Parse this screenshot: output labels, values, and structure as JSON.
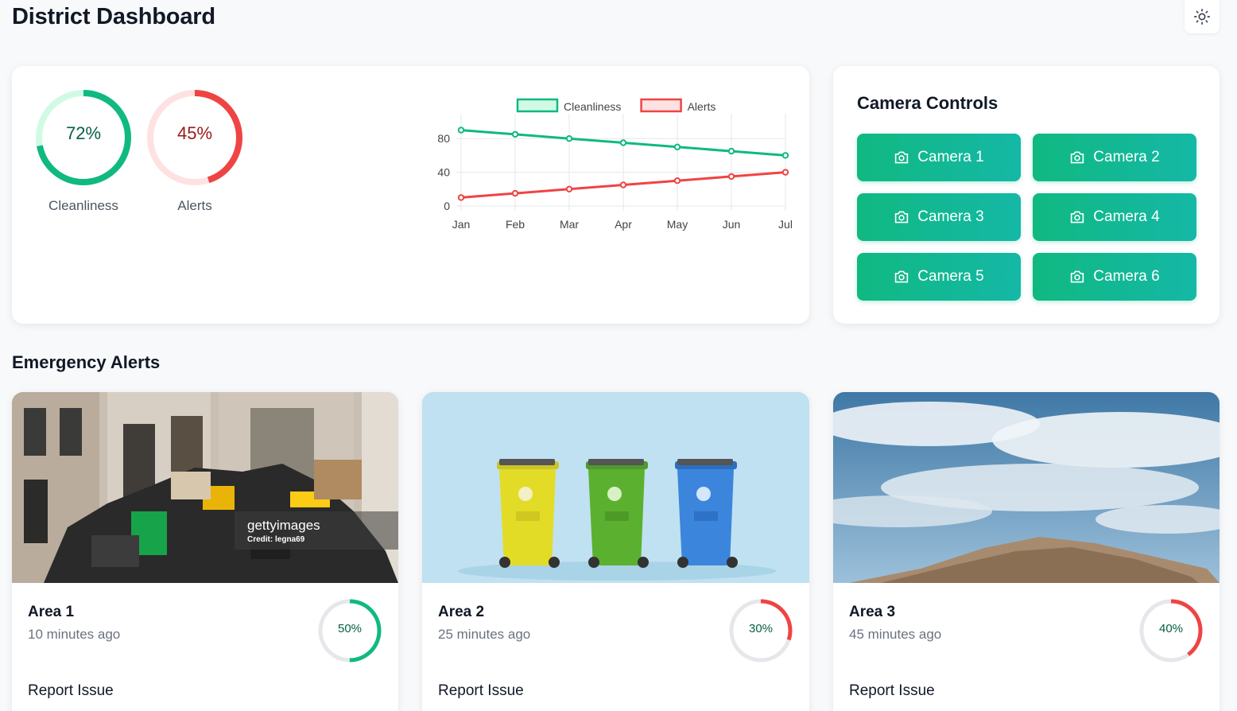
{
  "header": {
    "title": "District Dashboard",
    "theme_icon": "sun-icon"
  },
  "stats": {
    "gauges": [
      {
        "label": "Cleanliness",
        "value": 72,
        "display": "72%",
        "color": "#10b981",
        "track": "#d1fae5",
        "text_color": "#065f46"
      },
      {
        "label": "Alerts",
        "value": 45,
        "display": "45%",
        "color": "#ef4444",
        "track": "#fee2e2",
        "text_color": "#991b1b"
      }
    ]
  },
  "chart_data": {
    "type": "line",
    "categories": [
      "Jan",
      "Feb",
      "Mar",
      "Apr",
      "May",
      "Jun",
      "Jul"
    ],
    "series": [
      {
        "name": "Cleanliness",
        "color": "#10b981",
        "values": [
          90,
          85,
          80,
          75,
          70,
          65,
          60
        ]
      },
      {
        "name": "Alerts",
        "color": "#ef4444",
        "values": [
          10,
          15,
          20,
          25,
          30,
          35,
          40
        ]
      }
    ],
    "yticks": [
      0,
      40,
      80
    ],
    "ylim": [
      0,
      100
    ],
    "grid": true,
    "legend": "top"
  },
  "camera_controls": {
    "title": "Camera Controls",
    "icon": "camera-icon",
    "buttons": [
      "Camera 1",
      "Camera 2",
      "Camera 3",
      "Camera 4",
      "Camera 5",
      "Camera 6"
    ]
  },
  "emergency": {
    "title": "Emergency Alerts",
    "cards": [
      {
        "area": "Area 1",
        "time": "10 minutes ago",
        "percent": 50,
        "display": "50%",
        "color": "#10b981",
        "report": "Report Issue",
        "watermark": "gettyimages",
        "credit": "Credit: legna69"
      },
      {
        "area": "Area 2",
        "time": "25 minutes ago",
        "percent": 30,
        "display": "30%",
        "color": "#ef4444",
        "report": "Report Issue"
      },
      {
        "area": "Area 3",
        "time": "45 minutes ago",
        "percent": 40,
        "display": "40%",
        "color": "#ef4444",
        "report": "Report Issue"
      }
    ]
  }
}
